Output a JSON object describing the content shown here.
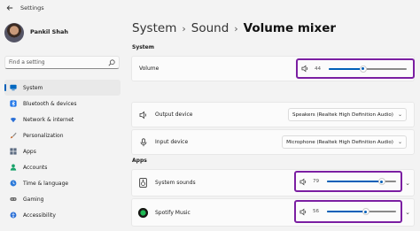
{
  "window": {
    "title": "Settings"
  },
  "profile": {
    "name": "Pankil Shah"
  },
  "search": {
    "placeholder": "Find a setting"
  },
  "sidebar": {
    "items": [
      {
        "label": "System",
        "icon": "monitor-icon",
        "color": "#0067c0",
        "active": true
      },
      {
        "label": "Bluetooth & devices",
        "icon": "bluetooth-icon",
        "color": "#1a73e8"
      },
      {
        "label": "Network & internet",
        "icon": "wifi-icon",
        "color": "#2a6fd6"
      },
      {
        "label": "Personalization",
        "icon": "brush-icon",
        "color": "#c46a2e"
      },
      {
        "label": "Apps",
        "icon": "apps-icon",
        "color": "#5a6a80"
      },
      {
        "label": "Accounts",
        "icon": "person-icon",
        "color": "#1aa36b"
      },
      {
        "label": "Time & language",
        "icon": "globe-clock-icon",
        "color": "#2b79d9"
      },
      {
        "label": "Gaming",
        "icon": "gamepad-icon",
        "color": "#6b6b6b"
      },
      {
        "label": "Accessibility",
        "icon": "accessibility-icon",
        "color": "#2a6fd6"
      }
    ]
  },
  "breadcrumb": {
    "level1": "System",
    "level2": "Sound",
    "current": "Volume mixer",
    "separator": "›"
  },
  "sections": {
    "system": "System",
    "apps": "Apps"
  },
  "volume": {
    "label": "Volume",
    "value": 44
  },
  "output": {
    "label": "Output device",
    "selected": "Speakers (Realtek High Definition Audio)"
  },
  "input": {
    "label": "Input device",
    "selected": "Microphone (Realtek High Definition Audio)"
  },
  "apps": [
    {
      "label": "System sounds",
      "value": 79,
      "icon": "system-sounds-icon"
    },
    {
      "label": "Spotify Music",
      "value": 56,
      "icon": "spotify-icon"
    }
  ],
  "accent": "#005fb8",
  "highlight": "#7b1fa2"
}
